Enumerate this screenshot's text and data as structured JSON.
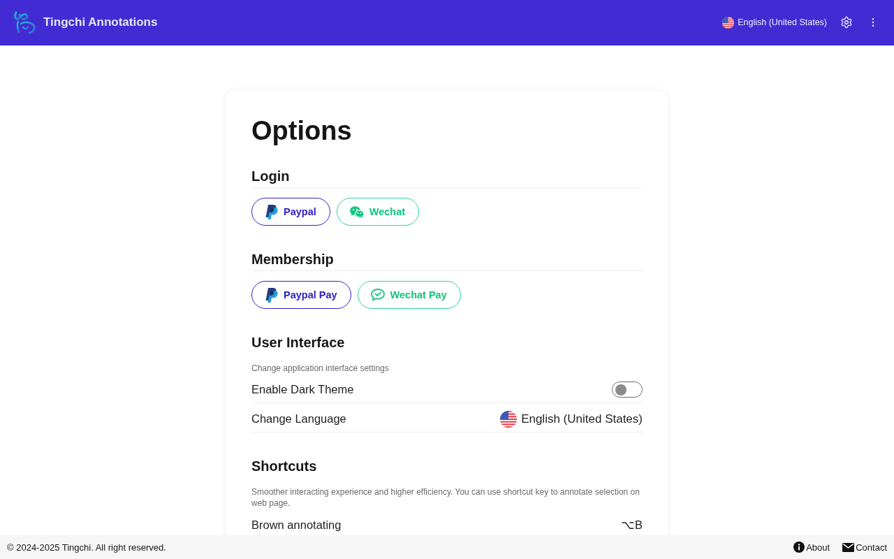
{
  "header": {
    "title": "Tingchi Annotations",
    "language": "English (United States)"
  },
  "page": {
    "title": "Options"
  },
  "sections": [
    {
      "kind": "buttons",
      "title": "Login",
      "buttons": [
        {
          "kind": "paypal",
          "label": "Paypal"
        },
        {
          "kind": "wechat",
          "label": "Wechat"
        }
      ]
    },
    {
      "kind": "buttons",
      "title": "Membership",
      "buttons": [
        {
          "kind": "paypal",
          "label": "Paypal Pay"
        },
        {
          "kind": "wechat-pay",
          "label": "Wechat Pay"
        }
      ]
    },
    {
      "kind": "settings",
      "title": "User Interface",
      "description": "Change application interface settings",
      "rows": [
        {
          "kind": "toggle",
          "label": "Enable Dark Theme",
          "on": false
        },
        {
          "kind": "language",
          "label": "Change Language",
          "value": "English (United States)"
        }
      ]
    },
    {
      "kind": "settings",
      "title": "Shortcuts",
      "description": "Smoother interacting experience and higher efficiency. You can use shortcut key to annotate selection on web page.",
      "rows": [
        {
          "kind": "shortcut",
          "label": "Brown annotating",
          "keys": "⌥B"
        }
      ]
    }
  ],
  "footer": {
    "copyright": "© 2024-2025 Tingchi. All right reserved.",
    "links": [
      {
        "kind": "info",
        "label": "About"
      },
      {
        "kind": "mail",
        "label": "Contact"
      }
    ]
  }
}
